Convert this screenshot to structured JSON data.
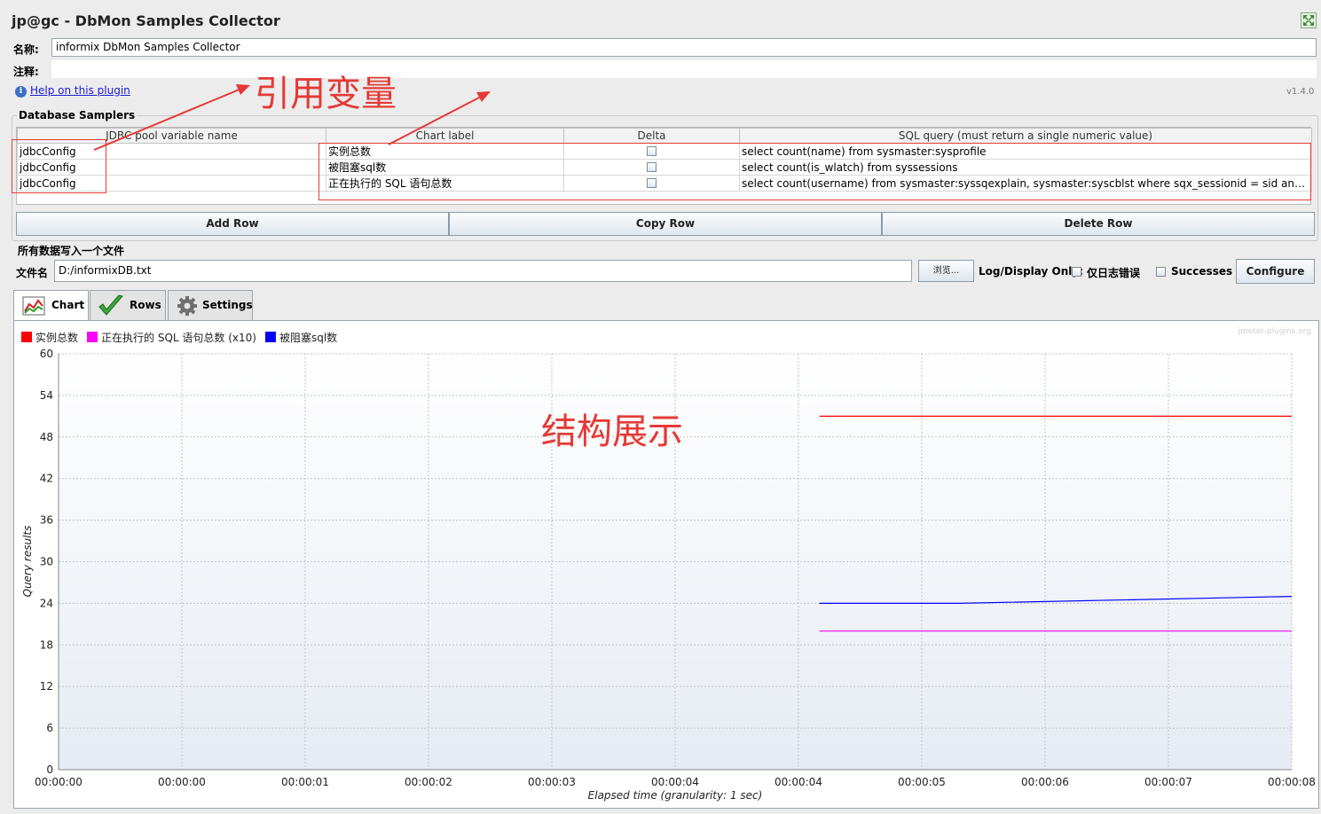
{
  "window": {
    "title": "jp@gc - DbMon Samples Collector"
  },
  "form": {
    "name_label": "名称:",
    "name_value": "informix  DbMon Samples Collector",
    "comment_label": "注释:",
    "comment_value": "",
    "help_link": "Help on this plugin",
    "version": "v1.4.0"
  },
  "samplers": {
    "group_title": "Database Samplers",
    "columns": [
      "JDBC pool variable name",
      "Chart label",
      "Delta",
      "SQL query (must return a single numeric value)"
    ],
    "rows": [
      {
        "pool": "jdbcConfig",
        "label": "实例总数",
        "delta": false,
        "sql": "select   count(name)   from sysmaster:sysprofile"
      },
      {
        "pool": "jdbcConfig",
        "label": "被阻塞sql数",
        "delta": false,
        "sql": "select  count(is_wlatch)  from syssessions"
      },
      {
        "pool": "jdbcConfig",
        "label": "正在执行的 SQL 语句总数",
        "delta": false,
        "sql": "select   count(username)   from sysmaster:syssqexplain, sysmaster:syscblst   where sqx_sessionid = sid   and sqx_iscurrent='Y' "
      }
    ],
    "buttons": {
      "add": "Add Row",
      "copy": "Copy Row",
      "delete": "Delete Row"
    }
  },
  "file_section": {
    "title": "所有数据写入一个文件",
    "file_label": "文件名",
    "file_value": "D:/informixDB.txt",
    "browse_label": "浏览...",
    "log_display_label": "Log/Display Only:",
    "errors_only_label": "仅日志错误",
    "successes_label": "Successes",
    "configure_label": "Configure",
    "errors_only_checked": false,
    "successes_checked": false
  },
  "tabs": [
    {
      "label": "Chart",
      "icon": "chart-icon",
      "active": true
    },
    {
      "label": "Rows",
      "icon": "checkmark-icon",
      "active": false
    },
    {
      "label": "Settings",
      "icon": "gear-icon",
      "active": false
    }
  ],
  "annotations": {
    "reference_vars": "引用变量",
    "structure_display": "结构展示"
  },
  "chart_data": {
    "type": "line",
    "watermark": "jmeter-plugins.org",
    "xlabel": "Elapsed time (granularity: 1 sec)",
    "ylabel": "Query results",
    "ylim": [
      0,
      60
    ],
    "yticks": [
      "0",
      "6",
      "12",
      "18",
      "24",
      "30",
      "36",
      "42",
      "48",
      "54",
      "60"
    ],
    "xlim_seconds": [
      0,
      10
    ],
    "xticks": [
      "00:00:00",
      "00:00:00",
      "00:00:01",
      "00:00:02",
      "00:00:03",
      "00:00:04",
      "00:00:04",
      "00:00:05",
      "00:00:06",
      "00:00:07",
      "00:00:08"
    ],
    "grid": true,
    "legend_position": "top-left",
    "series": [
      {
        "name": "实例总数",
        "color": "#ff0000",
        "x": [
          6.17,
          10
        ],
        "values": [
          51,
          51
        ]
      },
      {
        "name": "正在执行的 SQL 语句总数 (x10)",
        "color": "#ff00ff",
        "x": [
          6.17,
          10
        ],
        "values": [
          20,
          20
        ]
      },
      {
        "name": "被阻塞sql数",
        "color": "#0000ff",
        "x": [
          6.17,
          7.3,
          10
        ],
        "values": [
          24,
          24,
          25
        ]
      }
    ]
  }
}
